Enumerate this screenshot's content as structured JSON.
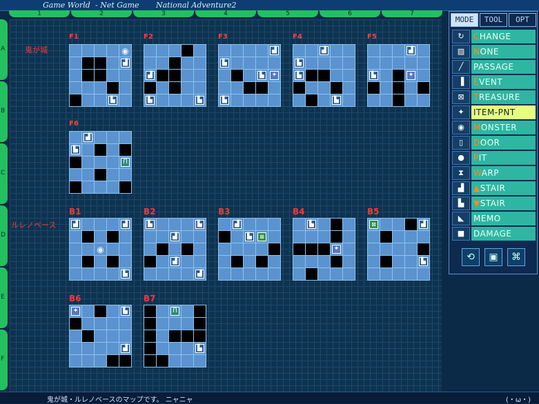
{
  "window": {
    "title": "Game World",
    "subtitle": "- Net Game",
    "app": "National Adventure2"
  },
  "grid": {
    "columns": [
      "1",
      "2",
      "3",
      "4",
      "5",
      "6",
      "7"
    ],
    "rows": [
      "A",
      "B",
      "C",
      "D",
      "E",
      "F"
    ]
  },
  "dungeons": [
    {
      "name": "鬼が城"
    },
    {
      "name": "ルレノベース"
    }
  ],
  "floors": [
    {
      "label": "F1",
      "cells": [
        "s",
        "s",
        "s",
        "s",
        "m",
        "s",
        "w",
        "w",
        "s",
        "u",
        "s",
        "w",
        "w",
        "s",
        "s",
        "s",
        "s",
        "s",
        "w",
        "s",
        "w",
        "s",
        "s",
        "d",
        "s"
      ]
    },
    {
      "label": "F2",
      "cells": [
        "s",
        "s",
        "s",
        "w",
        "s",
        "s",
        "s",
        "w",
        "s",
        "s",
        "u",
        "w",
        "w",
        "s",
        "s",
        "w",
        "s",
        "w",
        "s",
        "s",
        "d",
        "s",
        "s",
        "s",
        "d"
      ]
    },
    {
      "label": "F3",
      "cells": [
        "s",
        "s",
        "s",
        "s",
        "u",
        "d",
        "s",
        "s",
        "s",
        "s",
        "s",
        "w",
        "s",
        "d",
        "i",
        "s",
        "s",
        "w",
        "w",
        "s",
        "d",
        "s",
        "s",
        "s",
        "s"
      ]
    },
    {
      "label": "F4",
      "cells": [
        "s",
        "s",
        "u",
        "s",
        "s",
        "d",
        "s",
        "s",
        "s",
        "s",
        "d",
        "w",
        "w",
        "s",
        "s",
        "w",
        "s",
        "s",
        "w",
        "s",
        "s",
        "w",
        "s",
        "d",
        "s"
      ]
    },
    {
      "label": "F5",
      "cells": [
        "s",
        "s",
        "s",
        "u",
        "s",
        "s",
        "s",
        "s",
        "s",
        "s",
        "d",
        "s",
        "w",
        "i",
        "s",
        "w",
        "s",
        "w",
        "s",
        "w",
        "s",
        "s",
        "w",
        "s",
        "s"
      ]
    }
  ],
  "floorF6": {
    "label": "F6",
    "cells": [
      "s",
      "u",
      "s",
      "s",
      "s",
      "d",
      "s",
      "w",
      "s",
      "w",
      "w",
      "s",
      "s",
      "s",
      "r",
      "s",
      "s",
      "w",
      "s",
      "s",
      "w",
      "s",
      "s",
      "s",
      "w"
    ]
  },
  "basement": [
    {
      "label": "B1",
      "cells": [
        "u",
        "s",
        "s",
        "s",
        "u",
        "s",
        "w",
        "s",
        "w",
        "s",
        "s",
        "s",
        "m",
        "s",
        "s",
        "s",
        "w",
        "s",
        "w",
        "s",
        "s",
        "s",
        "s",
        "s",
        "d"
      ]
    },
    {
      "label": "B2",
      "cells": [
        "d",
        "s",
        "s",
        "s",
        "d",
        "s",
        "s",
        "u",
        "s",
        "s",
        "s",
        "w",
        "s",
        "w",
        "s",
        "w",
        "s",
        "u",
        "s",
        "s",
        "s",
        "s",
        "s",
        "s",
        "u"
      ]
    },
    {
      "label": "B3",
      "cells": [
        "s",
        "u",
        "s",
        "s",
        "s",
        "w",
        "s",
        "d",
        "t",
        "s",
        "s",
        "s",
        "s",
        "s",
        "w",
        "s",
        "w",
        "s",
        "w",
        "s",
        "s",
        "s",
        "s",
        "s",
        "s"
      ]
    },
    {
      "label": "B4",
      "cells": [
        "s",
        "d",
        "s",
        "w",
        "s",
        "s",
        "s",
        "s",
        "w",
        "s",
        "w",
        "w",
        "w",
        "i",
        "s",
        "s",
        "s",
        "s",
        "w",
        "s",
        "s",
        "w",
        "s",
        "s",
        "s"
      ]
    },
    {
      "label": "B5",
      "cells": [
        "t",
        "s",
        "s",
        "w",
        "u",
        "s",
        "w",
        "s",
        "s",
        "s",
        "s",
        "s",
        "s",
        "s",
        "w",
        "s",
        "w",
        "s",
        "s",
        "d",
        "s",
        "s",
        "s",
        "s",
        "s"
      ]
    }
  ],
  "basement2": [
    {
      "label": "B6",
      "cells": [
        "i",
        "s",
        "w",
        "s",
        "d",
        "w",
        "s",
        "s",
        "s",
        "s",
        "s",
        "w",
        "s",
        "s",
        "s",
        "s",
        "s",
        "s",
        "s",
        "u",
        "s",
        "s",
        "s",
        "w",
        "w"
      ]
    },
    {
      "label": "B7",
      "cells": [
        "w",
        "s",
        "r",
        "s",
        "w",
        "w",
        "s",
        "s",
        "s",
        "w",
        "w",
        "s",
        "w",
        "w",
        "w",
        "w",
        "s",
        "s",
        "s",
        "d",
        "w",
        "w",
        "s",
        "s",
        "s"
      ]
    }
  ],
  "panel": {
    "tabs": [
      "MODE",
      "TOOL",
      "OPT"
    ],
    "active_tab": "MODE",
    "items": [
      {
        "icon": "↻",
        "first": "C",
        "rest": "HANGE"
      },
      {
        "icon": "▨",
        "first": "N",
        "rest": "ONE"
      },
      {
        "icon": "╱",
        "first": "",
        "rest": "PASSAGE"
      },
      {
        "icon": "▐",
        "first": "E",
        "rest": "VENT"
      },
      {
        "icon": "⊠",
        "first": "T",
        "rest": "REASURE"
      },
      {
        "icon": "✦",
        "first": "",
        "rest": "ITEM-PNT"
      },
      {
        "icon": "◉",
        "first": "M",
        "rest": "ONSTER"
      },
      {
        "icon": "▯",
        "first": "D",
        "rest": "OOR"
      },
      {
        "icon": "●",
        "first": "P",
        "rest": "IT"
      },
      {
        "icon": "⧗",
        "first": "W",
        "rest": "ARP"
      },
      {
        "icon": "▟",
        "first": "▲",
        "rest": "STAIR"
      },
      {
        "icon": "▙",
        "first": "▼",
        "rest": "STAIR"
      },
      {
        "icon": "◣",
        "first": "",
        "rest": "MEMO"
      },
      {
        "icon": "■",
        "first": "",
        "rest": "DAMAGE"
      }
    ],
    "selected": "ITEM-PNT",
    "tool_buttons": [
      "⟲",
      "▣",
      "⌘"
    ]
  },
  "status": {
    "text": "鬼が城・ルレノベースのマップです。 ニャニャ",
    "face": "(・ω・)"
  }
}
